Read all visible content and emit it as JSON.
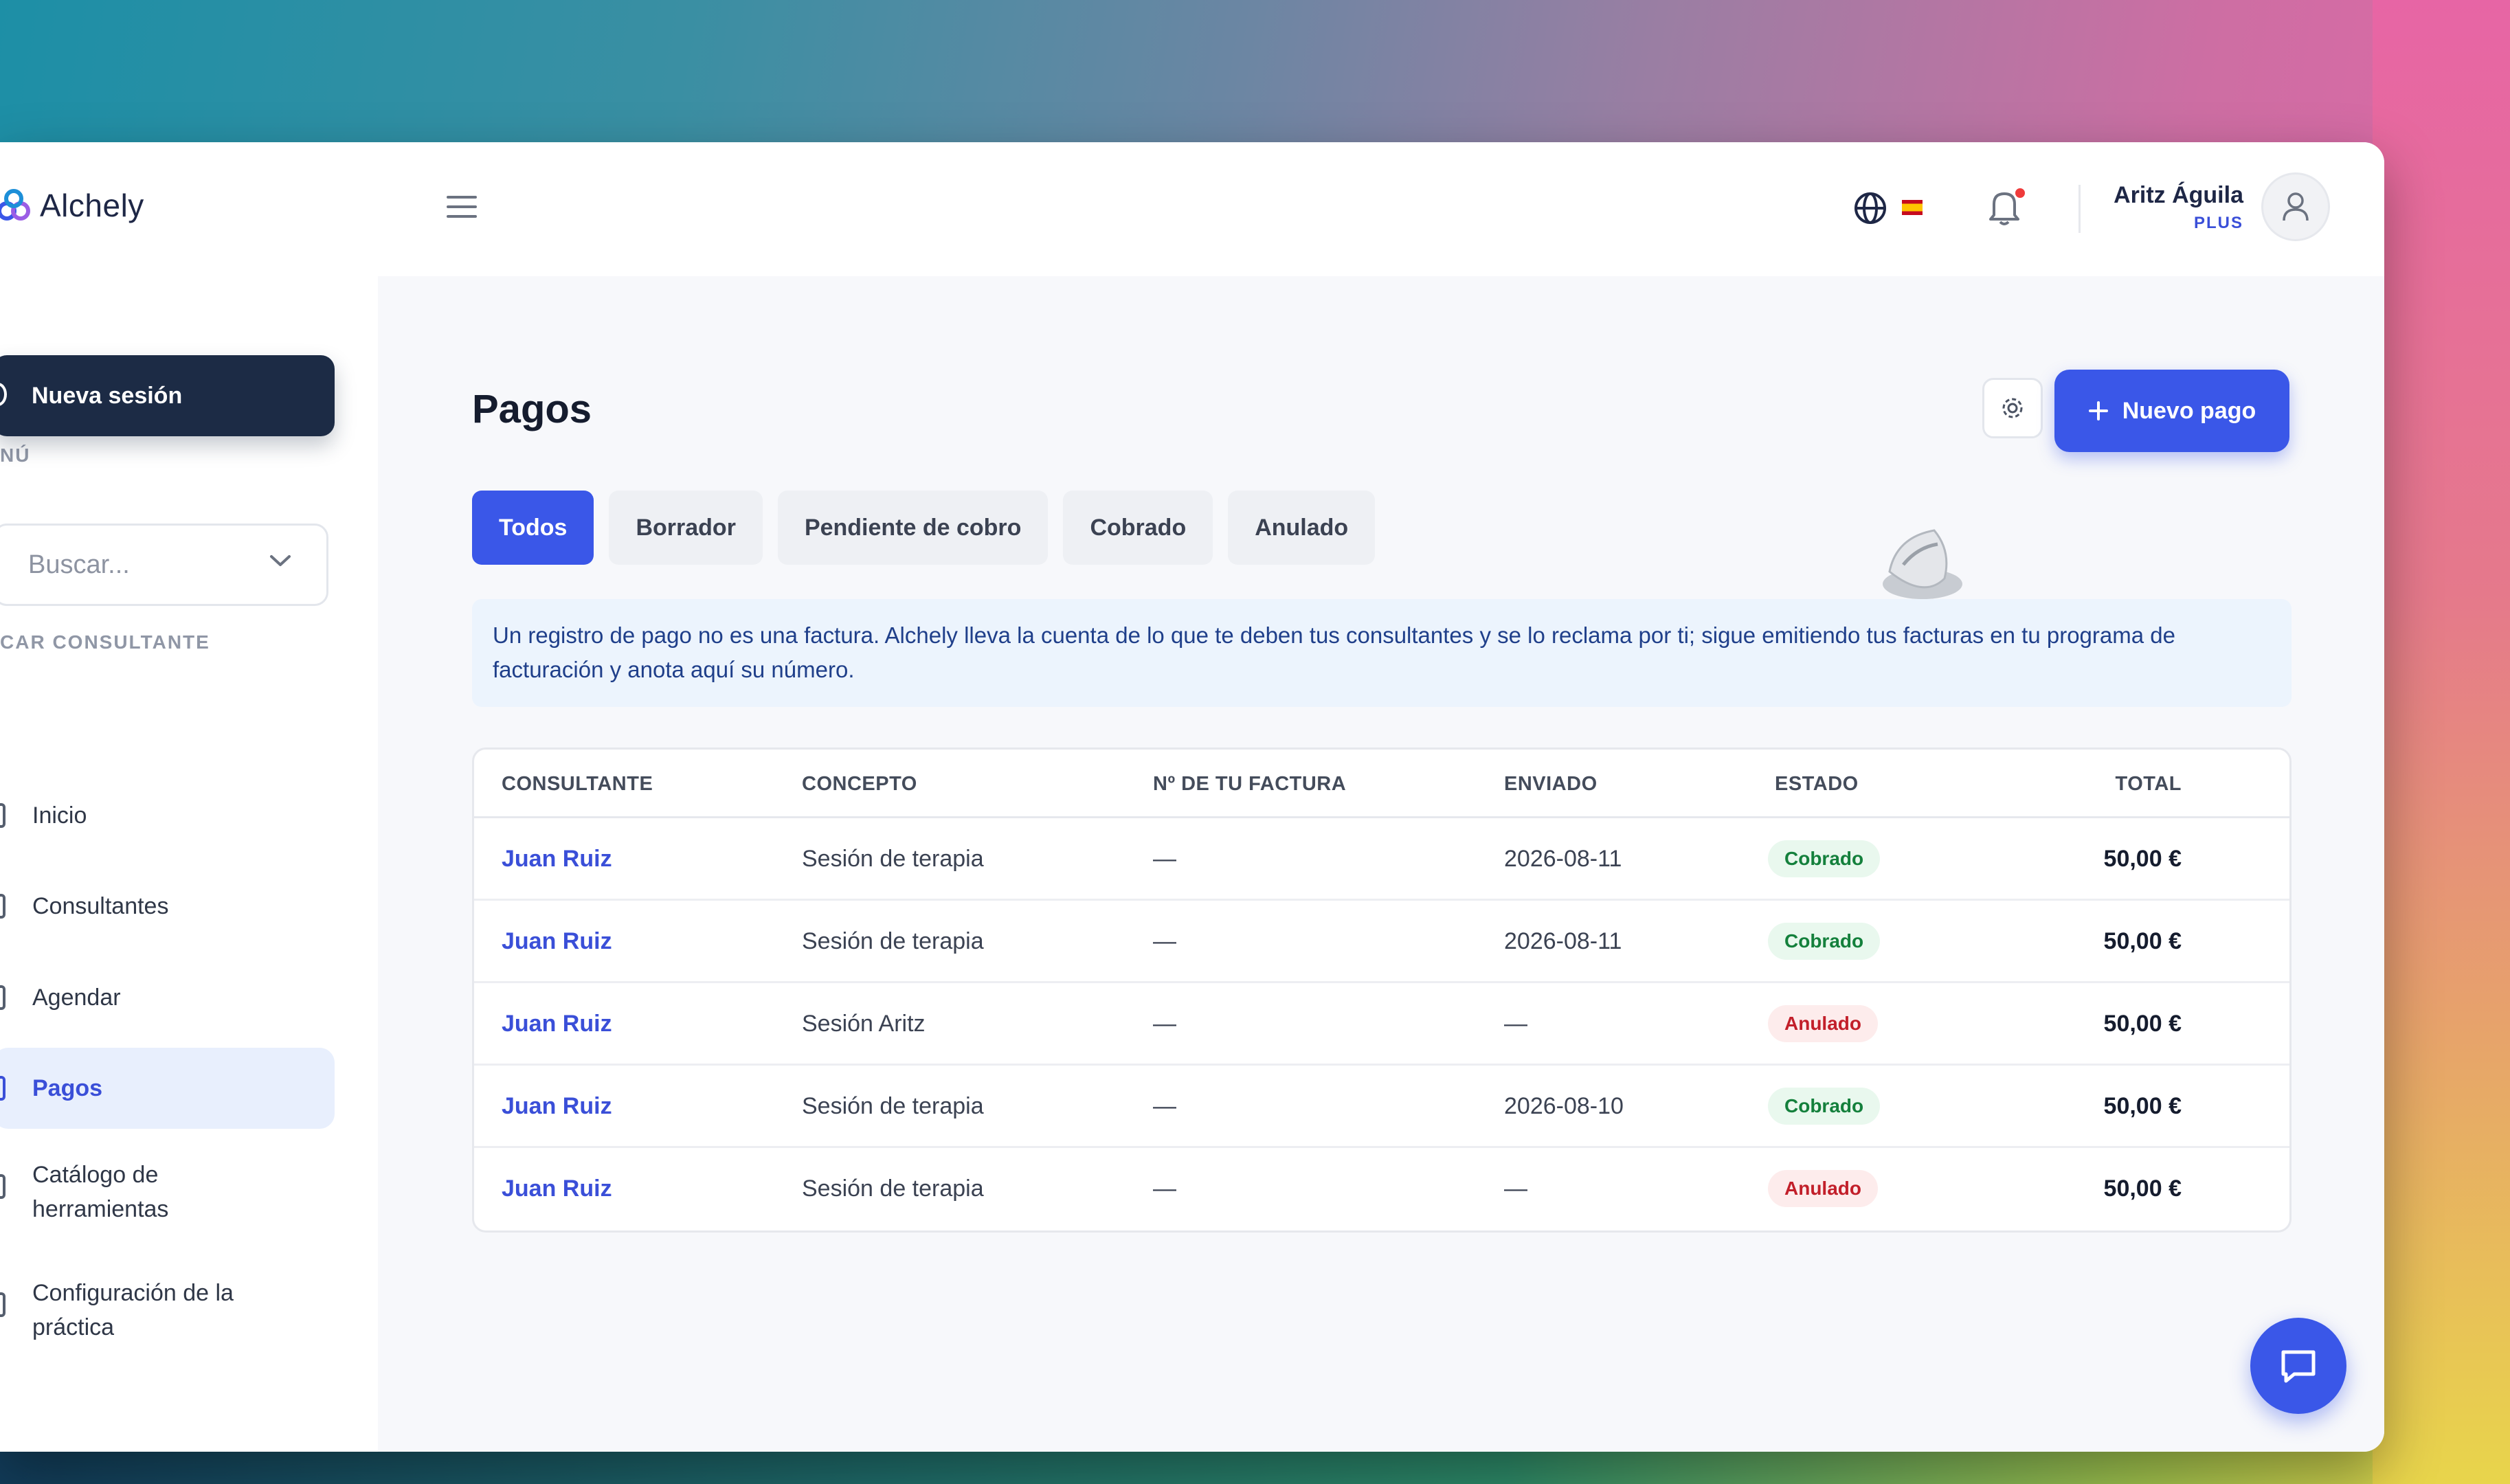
{
  "app": {
    "name": "Alchely"
  },
  "sidebar": {
    "menu_label": "NÚ",
    "new_session": "Nueva sesión",
    "search_label": "CAR CONSULTANTE",
    "search_placeholder": "Buscar...",
    "items": [
      {
        "label": "Inicio"
      },
      {
        "label": "Consultantes"
      },
      {
        "label": "Agendar"
      },
      {
        "label": "Pagos"
      },
      {
        "label_line1": "Catálogo de",
        "label_line2": "herramientas"
      },
      {
        "label_line1": "Configuración de la",
        "label_line2": "práctica"
      }
    ]
  },
  "header": {
    "user_name": "Aritz Águila",
    "user_plan": "PLUS"
  },
  "main": {
    "title": "Pagos",
    "new_payment_label": "Nuevo pago",
    "tabs": [
      "Todos",
      "Borrador",
      "Pendiente de cobro",
      "Cobrado",
      "Anulado"
    ],
    "active_tab": "Todos",
    "info_text": "Un registro de pago no es una factura. Alchely lleva la cuenta de lo que te deben tus consultantes y se lo reclama por ti; sigue emitiendo tus facturas en tu programa de facturación y anota aquí su número."
  },
  "table": {
    "headers": [
      "CONSULTANTE",
      "CONCEPTO",
      "Nº DE TU FACTURA",
      "ENVIADO",
      "ESTADO",
      "TOTAL"
    ],
    "rows": [
      {
        "client": "Juan Ruiz",
        "concept": "Sesión de terapia",
        "invoice": "—",
        "sent": "2026-08-11",
        "status": "Cobrado",
        "total": "50,00 €"
      },
      {
        "client": "Juan Ruiz",
        "concept": "Sesión de terapia",
        "invoice": "—",
        "sent": "2026-08-11",
        "status": "Cobrado",
        "total": "50,00 €"
      },
      {
        "client": "Juan Ruiz",
        "concept": "Sesión Aritz",
        "invoice": "—",
        "sent": "—",
        "status": "Anulado",
        "total": "50,00 €"
      },
      {
        "client": "Juan Ruiz",
        "concept": "Sesión de terapia",
        "invoice": "—",
        "sent": "2026-08-10",
        "status": "Cobrado",
        "total": "50,00 €"
      },
      {
        "client": "Juan Ruiz",
        "concept": "Sesión de terapia",
        "invoice": "—",
        "sent": "—",
        "status": "Anulado",
        "total": "50,00 €"
      }
    ]
  },
  "colors": {
    "accent": "#3a57e8",
    "dark": "#1c2b45",
    "status_ok": "#14803c",
    "status_cancel": "#c21f2a"
  }
}
